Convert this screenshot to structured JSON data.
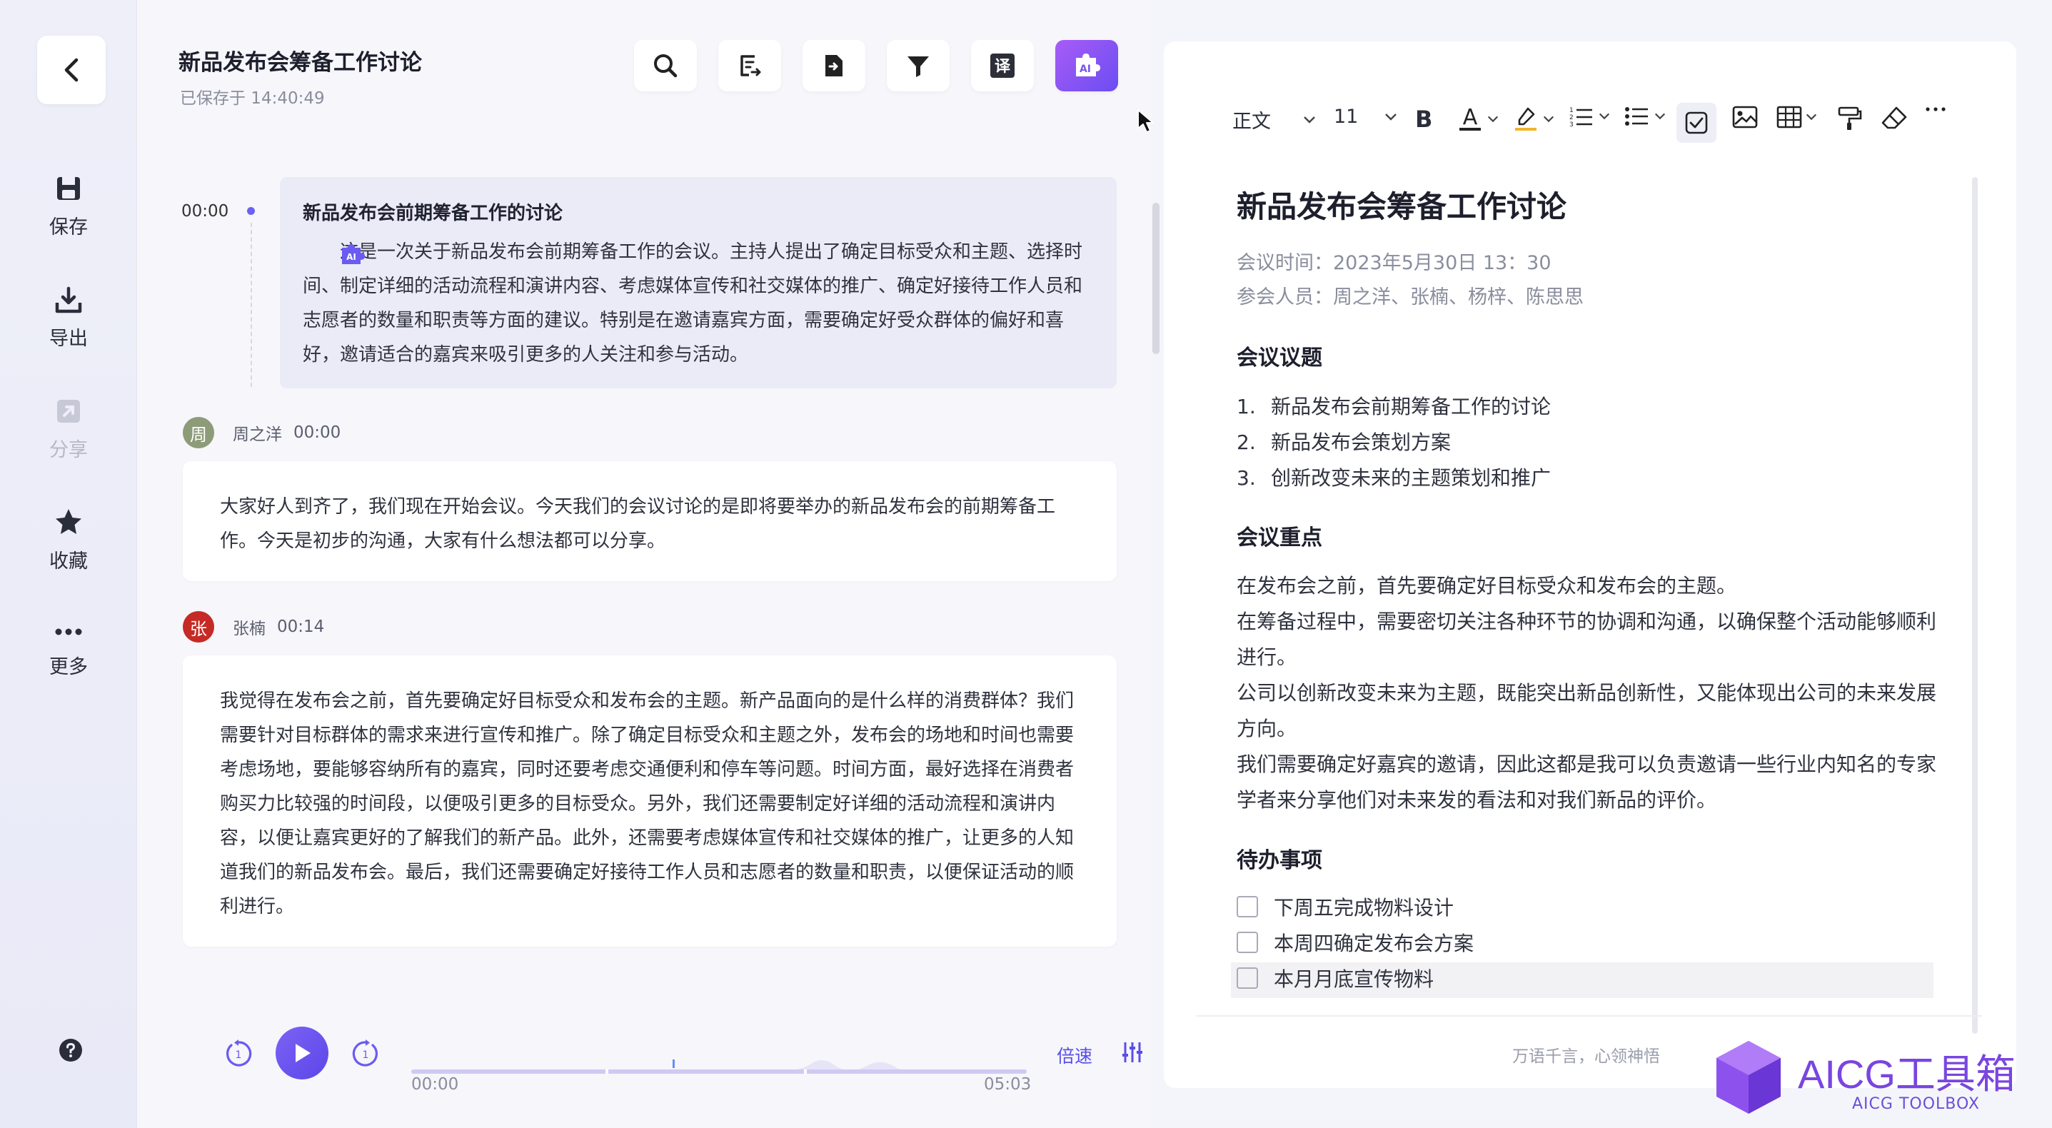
{
  "sidebar": {
    "items": [
      {
        "label": "保存",
        "icon": "save-icon"
      },
      {
        "label": "导出",
        "icon": "export-icon"
      },
      {
        "label": "分享",
        "icon": "share-icon",
        "disabled": true
      },
      {
        "label": "收藏",
        "icon": "star-icon"
      },
      {
        "label": "更多",
        "icon": "more-icon"
      }
    ]
  },
  "header": {
    "title": "新品发布会筹备工作讨论",
    "saved": "已保存于 14:40:49",
    "toolbar": {
      "translate_glyph": "译",
      "ai_glyph": "AI"
    }
  },
  "transcript": {
    "summary": {
      "time": "00:00",
      "title": "新品发布会前期筹备工作的讨论",
      "text": "这是一次关于新品发布会前期筹备工作的会议。主持人提出了确定目标受众和主题、选择时间、制定详细的活动流程和演讲内容、考虑媒体宣传和社交媒体的推广、确定好接待工作人员和志愿者的数量和职责等方面的建议。特别是在邀请嘉宾方面，需要确定好受众群体的偏好和喜好，邀请适合的嘉宾来吸引更多的人关注和参与活动。"
    },
    "messages": [
      {
        "avatar": "周",
        "speaker": "周之洋",
        "time": "00:00",
        "text": "大家好人到齐了，我们现在开始会议。今天我们的会议讨论的是即将要举办的新品发布会的前期筹备工作。今天是初步的沟通，大家有什么想法都可以分享。"
      },
      {
        "avatar": "张",
        "speaker": "张楠",
        "time": "00:14",
        "text": "我觉得在发布会之前，首先要确定好目标受众和发布会的主题。新产品面向的是什么样的消费群体？我们需要针对目标群体的需求来进行宣传和推广。除了确定目标受众和主题之外，发布会的场地和时间也需要考虑场地，要能够容纳所有的嘉宾，同时还要考虑交通便利和停车等问题。时间方面，最好选择在消费者购买力比较强的时间段，以便吸引更多的目标受众。另外，我们还需要制定好详细的活动流程和演讲内容，以便让嘉宾更好的了解我们的新产品。此外，还需要考虑媒体宣传和社交媒体的推广，让更多的人知道我们的新品发布会。最后，我们还需要确定好接待工作人员和志愿者的数量和职责，以便保证活动的顺利进行。"
      }
    ]
  },
  "player": {
    "current": "00:00",
    "total": "05:03",
    "speed_label": "倍速",
    "progress": 0.0
  },
  "editor": {
    "toolbar": {
      "style": "正文",
      "size": "11",
      "bold": "B",
      "font_color": "A"
    },
    "title": "新品发布会筹备工作讨论",
    "meeting_time": "会议时间：2023年5月30日 13：30",
    "attendees": "参会人员：周之洋、张楠、杨梓、陈思思",
    "topics_heading": "会议议题",
    "topics": [
      {
        "num": "1.",
        "text": "新品发布会前期筹备工作的讨论"
      },
      {
        "num": "2.",
        "text": "新品发布会策划方案"
      },
      {
        "num": "3.",
        "text": "创新改变未来的主题策划和推广"
      }
    ],
    "keypoints_heading": "会议重点",
    "keypoints": "在发布会之前，首先要确定好目标受众和发布会的主题。\n在筹备过程中，需要密切关注各种环节的协调和沟通，以确保整个活动能够顺利进行。\n公司以创新改变未来为主题，既能突出新品创新性，又能体现出公司的未来发展方向。\n我们需要确定好嘉宾的邀请，因此这都是我可以负责邀请一些行业内知名的专家学者来分享他们对未来发的看法和对我们新品的评价。",
    "todo_heading": "待办事项",
    "todos": [
      "下周五完成物料设计",
      "本周四确定发布会方案",
      "本月月底宣传物料"
    ],
    "footer": "万语千言，心领神悟"
  },
  "watermark": {
    "text": "AICG工具箱",
    "sub": "AICG TOOLBOX"
  },
  "colors": {
    "accent": "#6b4df2",
    "ai_gradient_start": "#a85cf6",
    "sidebar_bg": "#eeeff9"
  }
}
